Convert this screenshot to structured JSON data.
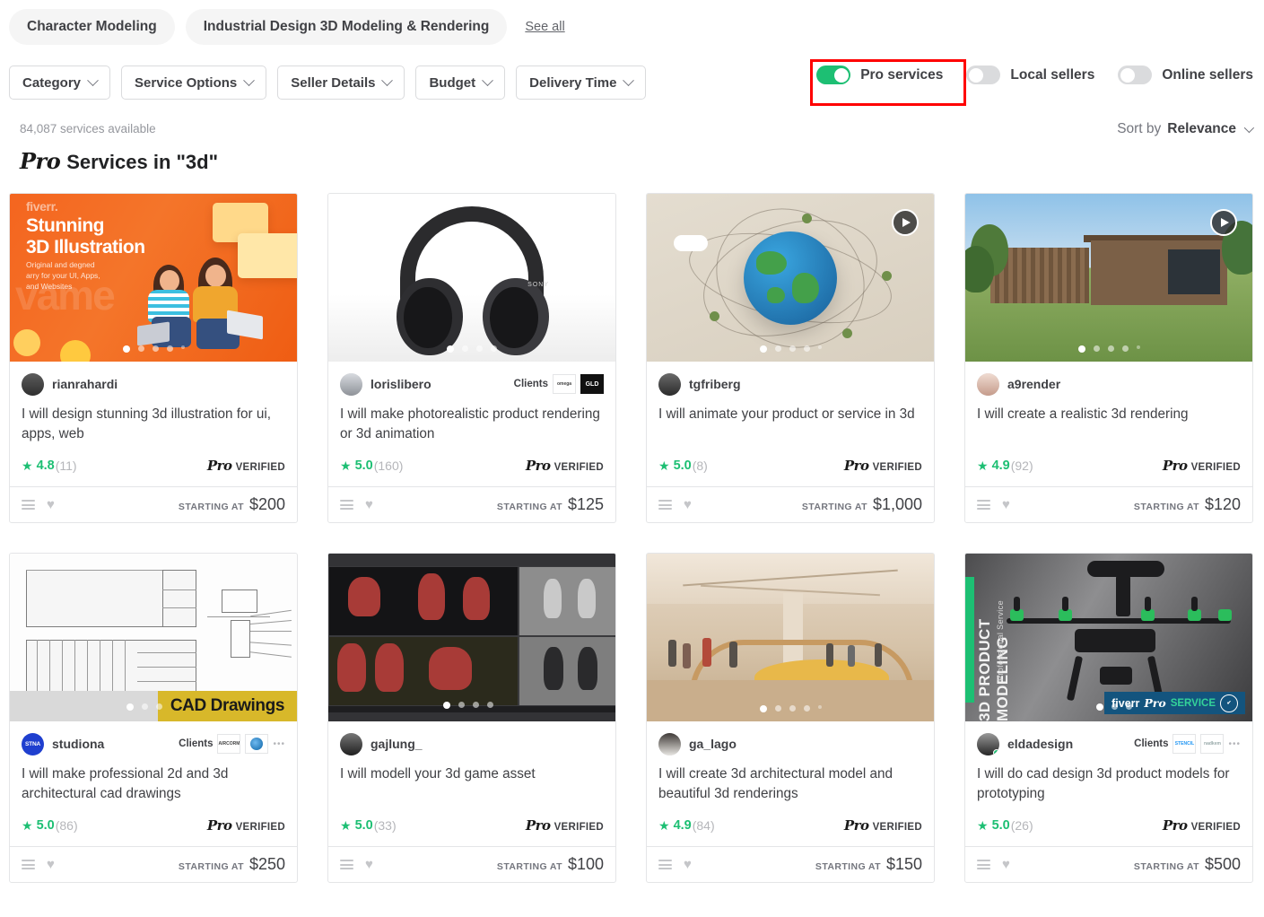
{
  "tags": [
    {
      "label": "Character Modeling"
    },
    {
      "label": "Industrial Design 3D Modeling & Rendering"
    }
  ],
  "see_all_label": "See all",
  "filters": [
    {
      "label": "Category"
    },
    {
      "label": "Service Options"
    },
    {
      "label": "Seller Details"
    },
    {
      "label": "Budget"
    },
    {
      "label": "Delivery Time"
    }
  ],
  "toggles": [
    {
      "label": "Pro services",
      "on": true,
      "highlighted": true
    },
    {
      "label": "Local sellers",
      "on": false,
      "highlighted": false
    },
    {
      "label": "Online sellers",
      "on": false,
      "highlighted": false
    }
  ],
  "results": {
    "count_text": "84,087 services available",
    "title_prefix": "Pro",
    "title_text": "Services in \"3d\"",
    "sort_label": "Sort by",
    "sort_value": "Relevance"
  },
  "colors": {
    "brand_green": "#1dbf73",
    "highlight_red": "#ff0000",
    "text_primary": "#404145",
    "text_muted": "#74767e",
    "rating_count": "#b5b6ba"
  },
  "cards": [
    {
      "seller": "rianrahardi",
      "title": "I will design stunning 3d illustration for ui, apps, web",
      "rating": "4.8",
      "reviews": "(11)",
      "badge_pro": "Pro",
      "badge_verified": "VERIFIED",
      "price_label": "STARTING AT",
      "price": "$200",
      "thumb_kind": "illustration",
      "thumb_text_brand": "fiverr.",
      "thumb_text_main": "Stunning\n3D Illustration",
      "thumb_text_sub": "Original and degned\narry for your UI, Apps,\nand Websites",
      "has_video": false,
      "dots": 5,
      "active_dot": 0,
      "clients_label": "",
      "clients": []
    },
    {
      "seller": "lorislibero",
      "title": "I will make photorealistic product rendering or 3d animation",
      "rating": "5.0",
      "reviews": "(160)",
      "badge_pro": "Pro",
      "badge_verified": "VERIFIED",
      "price_label": "STARTING AT",
      "price": "$125",
      "thumb_kind": "headphones",
      "has_video": false,
      "dots": 4,
      "active_dot": 0,
      "clients_label": "Clients",
      "clients": [
        {
          "name": "omega",
          "style": "light"
        },
        {
          "name": "GLD",
          "style": "dark"
        }
      ]
    },
    {
      "seller": "tgfriberg",
      "title": "I will animate your product or service in 3d",
      "rating": "5.0",
      "reviews": "(8)",
      "badge_pro": "Pro",
      "badge_verified": "VERIFIED",
      "price_label": "STARTING AT",
      "price": "$1,000",
      "thumb_kind": "globe",
      "has_video": true,
      "dots": 5,
      "active_dot": 0,
      "clients_label": "",
      "clients": []
    },
    {
      "seller": "a9render",
      "title": "I will create a realistic 3d rendering",
      "rating": "4.9",
      "reviews": "(92)",
      "badge_pro": "Pro",
      "badge_verified": "VERIFIED",
      "price_label": "STARTING AT",
      "price": "$120",
      "thumb_kind": "house",
      "has_video": true,
      "dots": 5,
      "active_dot": 0,
      "clients_label": "",
      "clients": []
    },
    {
      "seller": "studiona",
      "title": "I will make professional 2d and 3d architectural cad drawings",
      "rating": "5.0",
      "reviews": "(86)",
      "badge_pro": "Pro",
      "badge_verified": "VERIFIED",
      "price_label": "STARTING AT",
      "price": "$250",
      "thumb_kind": "cad",
      "thumb_banner": "CAD Drawings",
      "has_video": false,
      "dots": 3,
      "active_dot": 0,
      "avatar_kind": "brand",
      "avatar_text": "STNA",
      "clients_label": "Clients",
      "clients": [
        {
          "name": "AIRCORM",
          "style": "light"
        },
        {
          "name": "leaf",
          "style": "blue"
        }
      ],
      "clients_more": "•••"
    },
    {
      "seller": "gajlung_",
      "title": "I will modell your 3d game asset",
      "rating": "5.0",
      "reviews": "(33)",
      "badge_pro": "Pro",
      "badge_verified": "VERIFIED",
      "price_label": "STARTING AT",
      "price": "$100",
      "thumb_kind": "game",
      "has_video": false,
      "dots": 4,
      "active_dot": 0,
      "clients_label": "",
      "clients": []
    },
    {
      "seller": "ga_lago",
      "title": "I will create 3d architectural model and beautiful 3d renderings",
      "rating": "4.9",
      "reviews": "(84)",
      "badge_pro": "Pro",
      "badge_verified": "VERIFIED",
      "price_label": "STARTING AT",
      "price": "$150",
      "thumb_kind": "atrium",
      "has_video": false,
      "dots": 5,
      "active_dot": 0,
      "clients_label": "",
      "clients": []
    },
    {
      "seller": "eldadesign",
      "title": "I will do cad design 3d product models for prototyping",
      "rating": "5.0",
      "reviews": "(26)",
      "badge_pro": "Pro",
      "badge_verified": "VERIFIED",
      "price_label": "STARTING AT",
      "price": "$500",
      "thumb_kind": "drone",
      "thumb_vtitle": "3D PRODUCT MODELING",
      "thumb_vsub": "Professional Service",
      "thumb_badge_brand": "fiverr",
      "thumb_badge_pro": "Pro",
      "thumb_badge_service": "SERVICE",
      "has_video": false,
      "dots": 3,
      "active_dot": 0,
      "online": true,
      "clients_label": "Clients",
      "clients": [
        {
          "name": "STENCIL",
          "style": "light"
        },
        {
          "name": "nadkem",
          "style": "light"
        }
      ],
      "clients_more": "•••"
    }
  ],
  "icons": {
    "list": "list-icon",
    "heart": "heart-icon",
    "play": "play-icon",
    "star": "star-icon",
    "chevron": "chevron-down-icon"
  }
}
